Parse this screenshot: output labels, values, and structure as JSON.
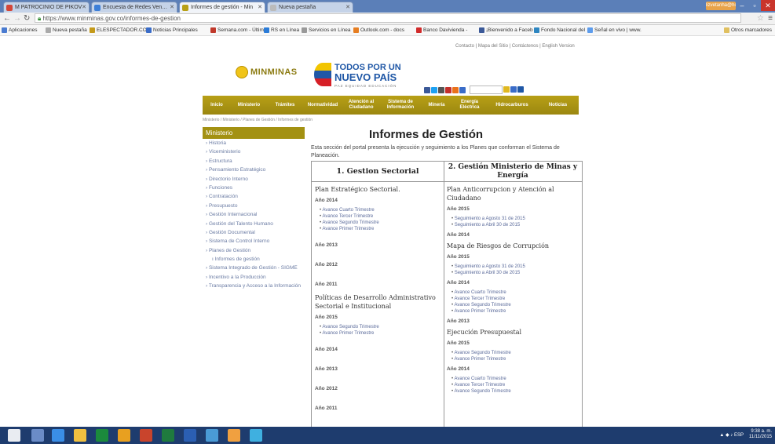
{
  "browser": {
    "tabs": [
      {
        "title": "M PATROCINIO DE PIKOV",
        "color": "#d44638",
        "active": false
      },
      {
        "title": "Encuesta de Redes Ven…",
        "color": "#3d7fd8",
        "active": false
      },
      {
        "title": "Informes de gestión - Min",
        "color": "#b8a016",
        "active": true
      },
      {
        "title": "Nueva pestaña",
        "color": "#bbbbbb",
        "active": false
      }
    ],
    "user_pill": "lizvetanha@hotm",
    "url": "https://www.minminas.gov.co/informes-de-gestion",
    "bookmarks": [
      {
        "label": "Aplicaciones",
        "color": "#4a7bd0"
      },
      {
        "label": "Nueva pestaña",
        "color": "#aaaaaa"
      },
      {
        "label": "ELESPECTADOR.COM",
        "color": "#c49a1a"
      },
      {
        "label": "Noticias Principales",
        "color": "#3a6cc8"
      },
      {
        "label": "Semana.com - Últim",
        "color": "#c0392b"
      },
      {
        "label": "RS en Línea",
        "color": "#2b7cd8"
      },
      {
        "label": "Servicios en Línea",
        "color": "#999999"
      },
      {
        "label": "Outlook.com - docs",
        "color": "#e67e22"
      },
      {
        "label": "Banco Davivienda -",
        "color": "#d12a2a"
      },
      {
        "label": "¡Bienvenido a Faceb",
        "color": "#3b5998"
      },
      {
        "label": "Fondo Nacional del",
        "color": "#2e86c1"
      },
      {
        "label": "Señal en vivo | www.",
        "color": "#5d9cec"
      },
      {
        "label": "Otros marcadores",
        "color": "#e0c060"
      }
    ]
  },
  "page": {
    "top_links": "Contacto | Mapa del Sitio | Contáctenos | English Version",
    "logo_text": "MINMINAS",
    "gov_logo_line1": "TODOS POR UN",
    "gov_logo_line2": "NUEVO PAÍS",
    "gov_logo_line3": "PAZ EQUIDAD EDUCACIÓN",
    "nav": [
      "Inicio",
      "Ministerio",
      "Trámites",
      "Normatividad",
      "Atención al Ciudadano",
      "Sistema de Información",
      "Minería",
      "Energía Eléctrica",
      "Hidrocarburos",
      "Noticias"
    ],
    "breadcrumb": "Ministerio / Ministerio / Planes de Gestión / Informes de gestión",
    "sidebar_title": "Ministerio",
    "sidebar": [
      {
        "label": "Historia",
        "sub": false
      },
      {
        "label": "Viceministerio",
        "sub": false
      },
      {
        "label": "Estructura",
        "sub": false
      },
      {
        "label": "Pensamiento Estratégico",
        "sub": false
      },
      {
        "label": "Directorio Interno",
        "sub": false
      },
      {
        "label": "Funciones",
        "sub": false
      },
      {
        "label": "Contratación",
        "sub": false
      },
      {
        "label": "Presupuesto",
        "sub": false
      },
      {
        "label": "Gestión Internacional",
        "sub": false
      },
      {
        "label": "Gestión del Talento Humano",
        "sub": false
      },
      {
        "label": "Gestión Documental",
        "sub": false
      },
      {
        "label": "Sistema de Control Interno",
        "sub": false
      },
      {
        "label": "Planes de Gestión",
        "sub": false
      },
      {
        "label": "Informes de gestión",
        "sub": true
      },
      {
        "label": "Sistema Integrado de Gestión - SIGME",
        "sub": false
      },
      {
        "label": "Incentivo a la Producción",
        "sub": false
      },
      {
        "label": "Transparencia y Acceso a la Información",
        "sub": false
      }
    ],
    "title": "Informes de Gestión",
    "intro": "Esta sección del portal presenta la ejecución y seguimiento a los Planes que conforman el Sistema de Planeación.",
    "col1_header": "1. Gestion Sectorial",
    "col2_header": "2. Gestión Ministerio de Minas y Energía",
    "col1": {
      "s1": "Plan Estratégico Sectorial.",
      "y2014": "Año 2014",
      "l1": "Avance Cuarto Trimestre",
      "l2": "Avance Tercer Trimestre",
      "l3": "Avance Segundo Trimestre",
      "l4": "Avance Primer Trimestre",
      "y2013": "Año 2013",
      "y2012": "Año 2012",
      "y2011": "Año 2011",
      "s2": "Políticas de Desarrollo Administrativo Sectorial e Institucional",
      "y2015": "Año 2015",
      "l5": "Avance Segundo Trimestre",
      "l6": "Avance Primer Trimestre",
      "y2014b": "Año 2014",
      "y2013b": "Año 2013",
      "y2012b": "Año 2012",
      "y2011b": "Año 2011"
    },
    "col2": {
      "s1": "Plan Anticorrupcion y Atención al Ciudadano",
      "y2015": "Año 2015",
      "l1": "Seguimiento a Agosto 31 de 2015",
      "l2": "Seguimiento a Abril 30 de 2015",
      "y2014": "Año 2014",
      "s2": "Mapa de Riesgos de Corrupción",
      "y2015b": "Año 2015",
      "l3": "Seguimiento a Agosto 31 de 2015",
      "l4": "Seguimiento a Abril 30 de 2015",
      "y2014b": "Año 2014",
      "l5": "Avance Cuarto Trimestre",
      "l6": "Avance Tercer Trimestre",
      "l7": "Avance Segundo Trimestre",
      "l8": "Avance Primer Trimestre",
      "y2013": "Año 2013",
      "s3": "Ejecución Presupuestal",
      "y2015c": "Año 2015",
      "l9": "Avance Segundo Trimestre",
      "l10": "Avance Primer Trimestre",
      "y2014c": "Año 2014",
      "l11": "Avance Cuarto Trimestre",
      "l12": "Avance Tercer Trimestre",
      "l13": "Avance Segundo Trimestre"
    }
  },
  "taskbar": {
    "time": "9:38 a. m.",
    "date": "11/11/2015",
    "lang": "ESP"
  }
}
